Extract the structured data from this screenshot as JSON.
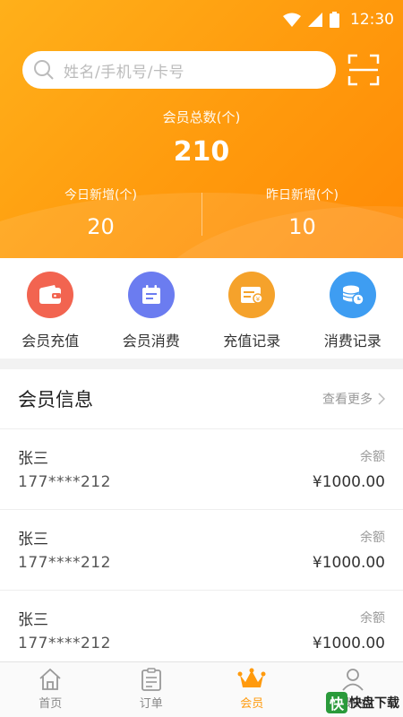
{
  "status_bar": {
    "time": "12:30"
  },
  "search": {
    "placeholder": "姓名/手机号/卡号"
  },
  "summary": {
    "total_label": "会员总数(个)",
    "total_value": "210",
    "today_label": "今日新增(个)",
    "today_value": "20",
    "yesterday_label": "昨日新增(个)",
    "yesterday_value": "10"
  },
  "quick_actions": [
    {
      "label": "会员充值",
      "icon": "wallet-icon",
      "color": "#f26450"
    },
    {
      "label": "会员消费",
      "icon": "calendar-icon",
      "color": "#6b7cf0"
    },
    {
      "label": "充值记录",
      "icon": "record-icon",
      "color": "#f5a22b"
    },
    {
      "label": "消费记录",
      "icon": "coins-clock-icon",
      "color": "#3e9df2"
    }
  ],
  "member_info": {
    "title": "会员信息",
    "more_label": "查看更多",
    "balance_label": "余额",
    "members": [
      {
        "name": "张三",
        "phone": "177****212",
        "balance": "¥1000.00"
      },
      {
        "name": "张三",
        "phone": "177****212",
        "balance": "¥1000.00"
      },
      {
        "name": "张三",
        "phone": "177****212",
        "balance": "¥1000.00"
      }
    ]
  },
  "tabs": [
    {
      "label": "首页",
      "icon": "home-icon",
      "active": false
    },
    {
      "label": "订单",
      "icon": "order-icon",
      "active": false
    },
    {
      "label": "会员",
      "icon": "crown-icon",
      "active": true
    },
    {
      "label": "我的",
      "icon": "user-icon",
      "active": false
    }
  ],
  "colors": {
    "accent": "#ff9a0d",
    "header_start": "#ffb01a",
    "header_end": "#ff8a05"
  },
  "watermark": {
    "text": "快盘下载"
  }
}
